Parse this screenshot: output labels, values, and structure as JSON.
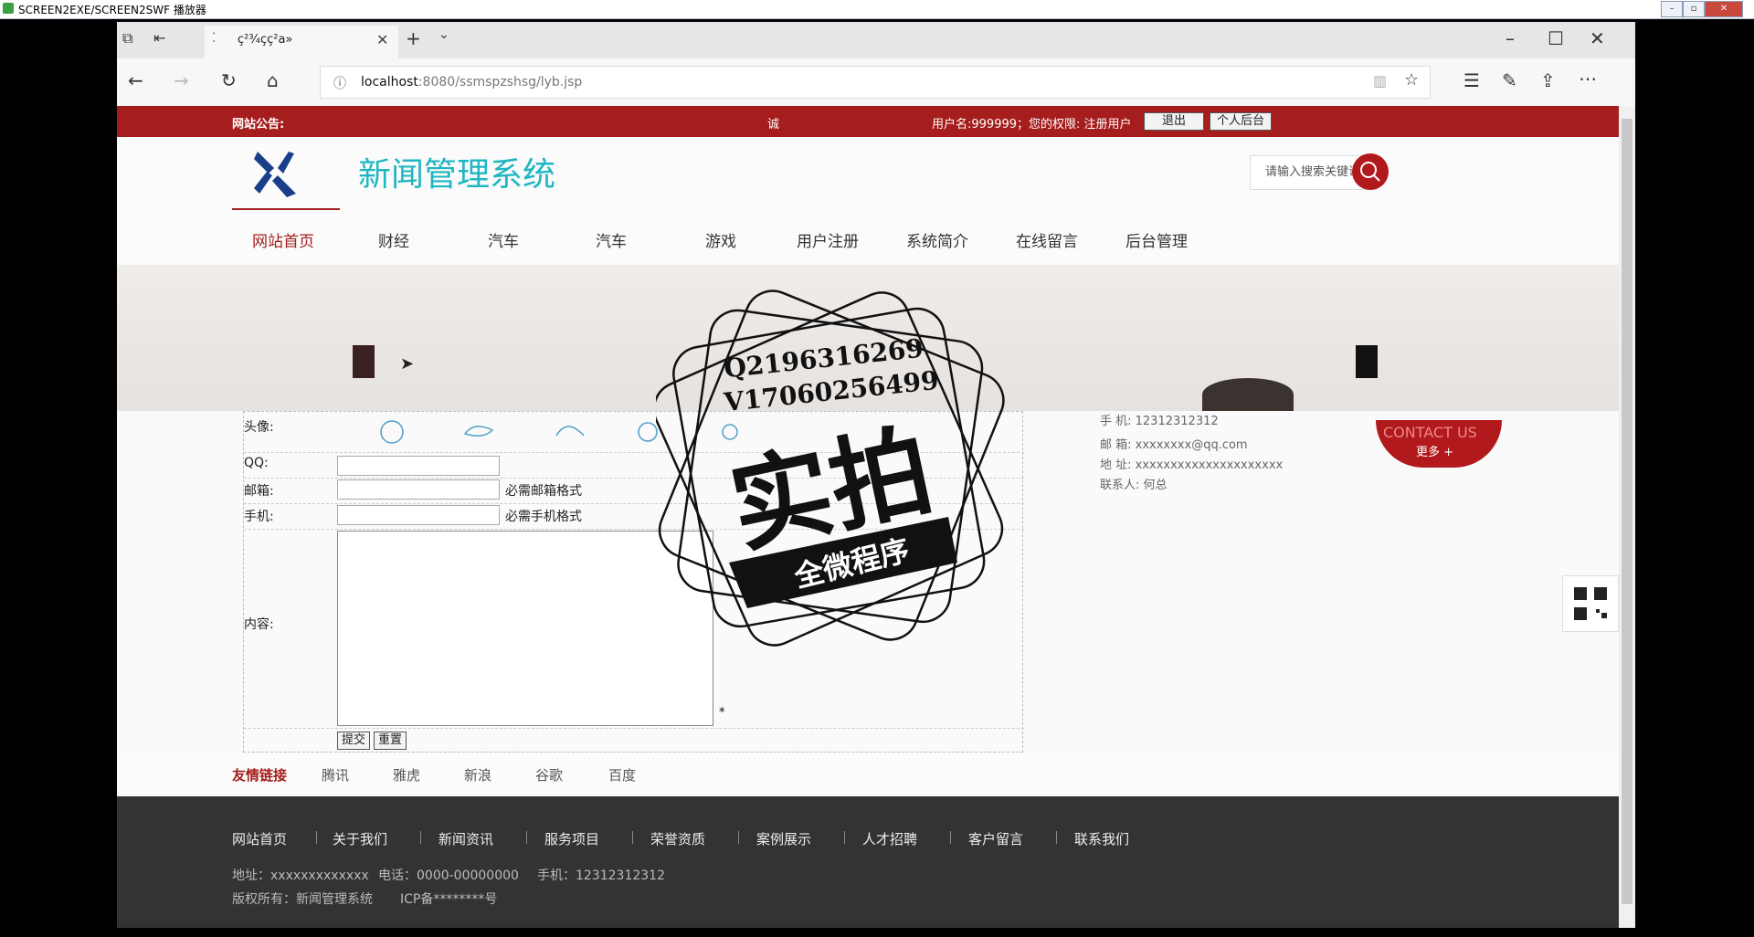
{
  "player": {
    "title": "SCREEN2EXE/SCREEN2SWF 播放器"
  },
  "browser": {
    "tab_title": "ç²¾ç­ç²a»",
    "url_host": "localhost",
    "url_rest": ":8080/ssmspzshsg/lyb.jsp"
  },
  "notice": {
    "label": "网站公告:",
    "text": "诚",
    "user_info": "用户名:999999；您的权限: 注册用户",
    "logout": "退出",
    "admin": "个人后台"
  },
  "header": {
    "title": "新闻管理系统",
    "search_placeholder": "请输入搜索关键词"
  },
  "nav": [
    "网站首页",
    "财经",
    "汽车",
    "汽车",
    "游戏",
    "用户注册",
    "系统简介",
    "在线留言",
    "后台管理"
  ],
  "form": {
    "avatar_label": "头像:",
    "qq_label": "QQ:",
    "email_label": "邮箱:",
    "email_hint": "必需邮箱格式",
    "phone_label": "手机:",
    "phone_hint": "必需手机格式",
    "content_label": "内容:",
    "required_mark": "*",
    "submit": "提交",
    "reset": "重置"
  },
  "contact": {
    "phone": "手    机:  12312312312",
    "email": "邮    箱:  xxxxxxxx@qq.com",
    "address": "地    址:  xxxxxxxxxxxxxxxxxxxxx",
    "person": "联系人:  何总",
    "badge": "CONTACT US",
    "more": "更多 +"
  },
  "watermark": {
    "line1": "Q2196316269",
    "line2": "V17060256499",
    "big": "实拍",
    "ribbon": "全微程序"
  },
  "friend_links": {
    "label": "友情链接",
    "links": [
      "腾讯",
      "雅虎",
      "新浪",
      "谷歌",
      "百度"
    ]
  },
  "footer": {
    "nav": [
      "网站首页",
      "关于我们",
      "新闻资讯",
      "服务项目",
      "荣誉资质",
      "案例展示",
      "人才招聘",
      "客户留言",
      "联系我们"
    ],
    "address": "地址：xxxxxxxxxxxxx",
    "tel": "电话：0000-00000000",
    "mobile": "手机：12312312312",
    "copyright": "版权所有：新闻管理系统",
    "icp": "ICP备********号"
  },
  "colors": {
    "brand_red": "#a51d1d",
    "title_teal": "#1fb6c2",
    "footer_bg": "#333333"
  }
}
